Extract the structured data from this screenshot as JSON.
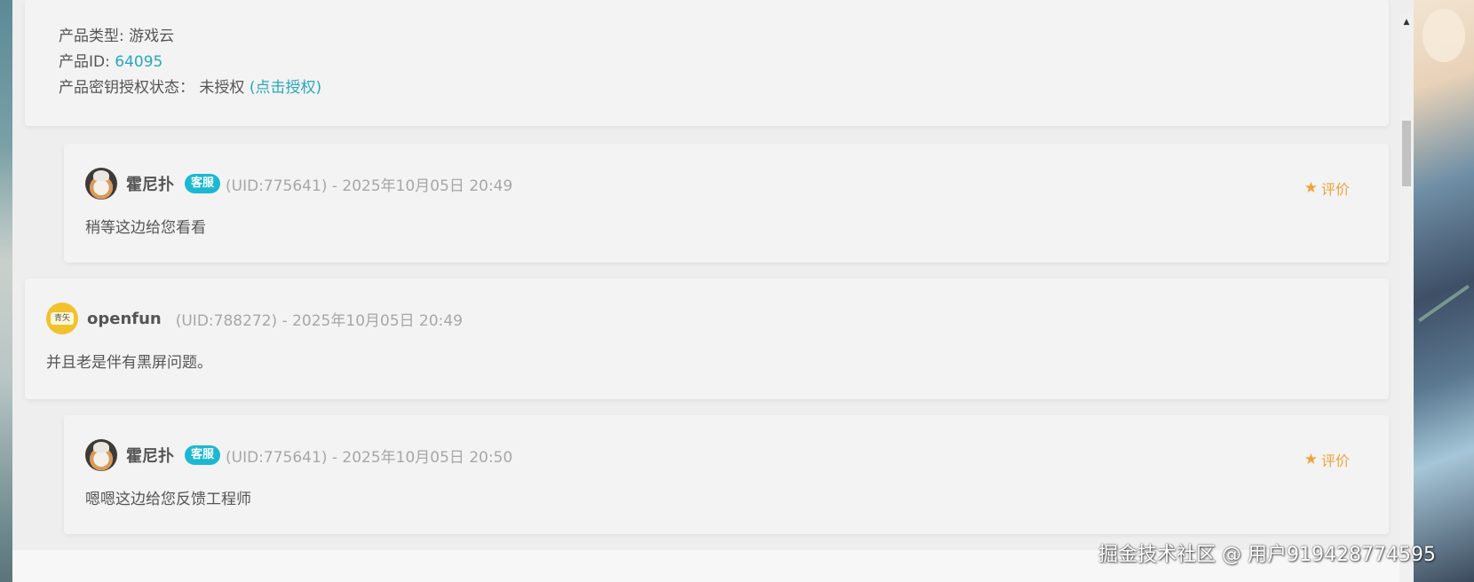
{
  "product_info": {
    "type_label": "产品类型: 游戏云",
    "id_label": "产品ID: ",
    "id_value": "64095",
    "auth_label": "产品密钥授权状态：  未授权 ",
    "auth_link": "(点击授权)"
  },
  "messages": [
    {
      "username": "霍尼扑",
      "badge": "客服",
      "meta": "(UID:775641) - 2025年10月05日 20:49",
      "body": "稍等这边给您看看",
      "rate_label": "评价",
      "avatar_icon": "cat-avatar-icon"
    },
    {
      "username": "openfun",
      "badge": "",
      "meta": "(UID:788272) - 2025年10月05日 20:49",
      "body": "并且老是伴有黑屏问题。",
      "avatar_icon": "yellow-avatar-icon"
    },
    {
      "username": "霍尼扑",
      "badge": "客服",
      "meta": "(UID:775641) - 2025年10月05日 20:50",
      "body": "嗯嗯这边给您反馈工程师",
      "rate_label": "评价",
      "avatar_icon": "cat-avatar-icon"
    }
  ],
  "avatar_text": "青矢",
  "watermark": "掘金技术社区 @ 用户919428774595",
  "colors": {
    "accent_link": "#2aa7b8",
    "badge_bg": "#1cb8d2",
    "rate_color": "#f0a33a",
    "meta_text": "#a7a7a7"
  }
}
